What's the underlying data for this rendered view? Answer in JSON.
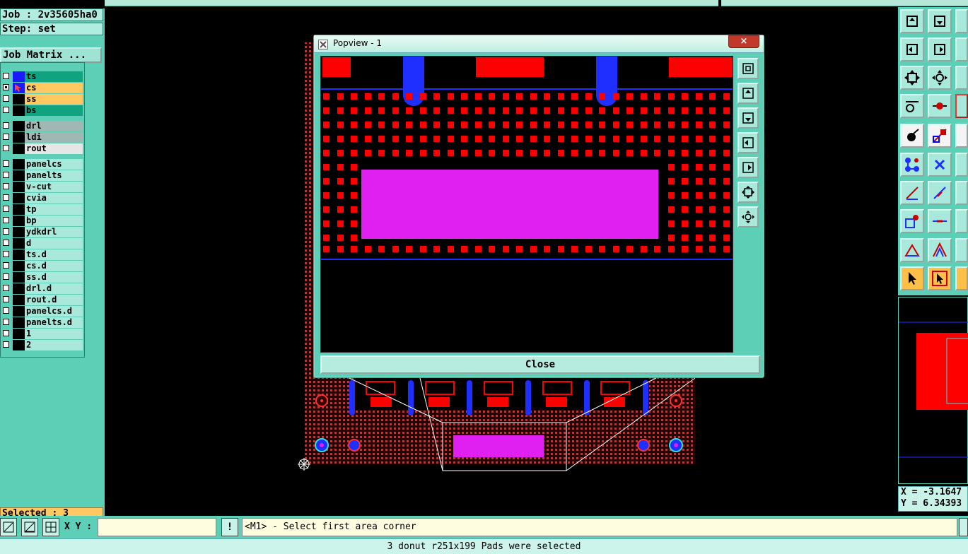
{
  "app": {
    "job_line": "Job : 2v35605ha0",
    "step_line": "Step: set",
    "job_matrix_button": "Job Matrix ...",
    "selected_text": "Selected : 3"
  },
  "layers": [
    {
      "name": "ts",
      "bg": "#0fa37f",
      "color": "#1a1aff",
      "checked": false
    },
    {
      "name": "cs",
      "bg": "#ffc861",
      "color": "#1a1aff",
      "checked": true,
      "active": true
    },
    {
      "name": "ss",
      "bg": "#ffc861",
      "color": "#000000",
      "checked": false
    },
    {
      "name": "bs",
      "bg": "#0fa37f",
      "color": "#000000",
      "checked": false
    },
    {
      "name": "drl",
      "bg": "#9fb8b3",
      "color": "#000000",
      "checked": false
    },
    {
      "name": "ldi",
      "bg": "#9fb8b3",
      "color": "#000000",
      "checked": false
    },
    {
      "name": "rout",
      "bg": "#e6e6e6",
      "color": "#000000",
      "checked": false
    },
    {
      "name": "panelcs",
      "bg": "#a9e9db",
      "color": "#000000",
      "checked": false
    },
    {
      "name": "panelts",
      "bg": "#a9e9db",
      "color": "#000000",
      "checked": false
    },
    {
      "name": "v-cut",
      "bg": "#a9e9db",
      "color": "#000000",
      "checked": false
    },
    {
      "name": "cvia",
      "bg": "#a9e9db",
      "color": "#000000",
      "checked": false
    },
    {
      "name": "tp",
      "bg": "#a9e9db",
      "color": "#000000",
      "checked": false
    },
    {
      "name": "bp",
      "bg": "#a9e9db",
      "color": "#000000",
      "checked": false
    },
    {
      "name": "ydkdrl",
      "bg": "#a9e9db",
      "color": "#000000",
      "checked": false
    },
    {
      "name": "d",
      "bg": "#a9e9db",
      "color": "#000000",
      "checked": false
    },
    {
      "name": "ts.d",
      "bg": "#a9e9db",
      "color": "#000000",
      "checked": false
    },
    {
      "name": "cs.d",
      "bg": "#a9e9db",
      "color": "#000000",
      "checked": false
    },
    {
      "name": "ss.d",
      "bg": "#a9e9db",
      "color": "#000000",
      "checked": false
    },
    {
      "name": "drl.d",
      "bg": "#a9e9db",
      "color": "#000000",
      "checked": false
    },
    {
      "name": "rout.d",
      "bg": "#a9e9db",
      "color": "#000000",
      "checked": false
    },
    {
      "name": "panelcs.d",
      "bg": "#a9e9db",
      "color": "#000000",
      "checked": false
    },
    {
      "name": "panelts.d",
      "bg": "#a9e9db",
      "color": "#000000",
      "checked": false
    },
    {
      "name": "1",
      "bg": "#a9e9db",
      "color": "#000000",
      "checked": false
    },
    {
      "name": "2",
      "bg": "#a9e9db",
      "color": "#000000",
      "checked": false
    }
  ],
  "popview": {
    "title": "Popview - 1",
    "close_button": "Close",
    "close_x": "×"
  },
  "coords": {
    "x": "X = -3.1647",
    "y": "Y = 6.34393"
  },
  "bottom": {
    "xy_label": "X Y :",
    "xy_value": "",
    "prompt": "<M1> - Select first area corner",
    "status": "3 donut r251x199 Pads were selected"
  },
  "colors": {
    "panel": "#5ecfb7",
    "pad_red": "#ff0000",
    "trace_blue": "#1e2fff",
    "magenta": "#e020f0"
  }
}
